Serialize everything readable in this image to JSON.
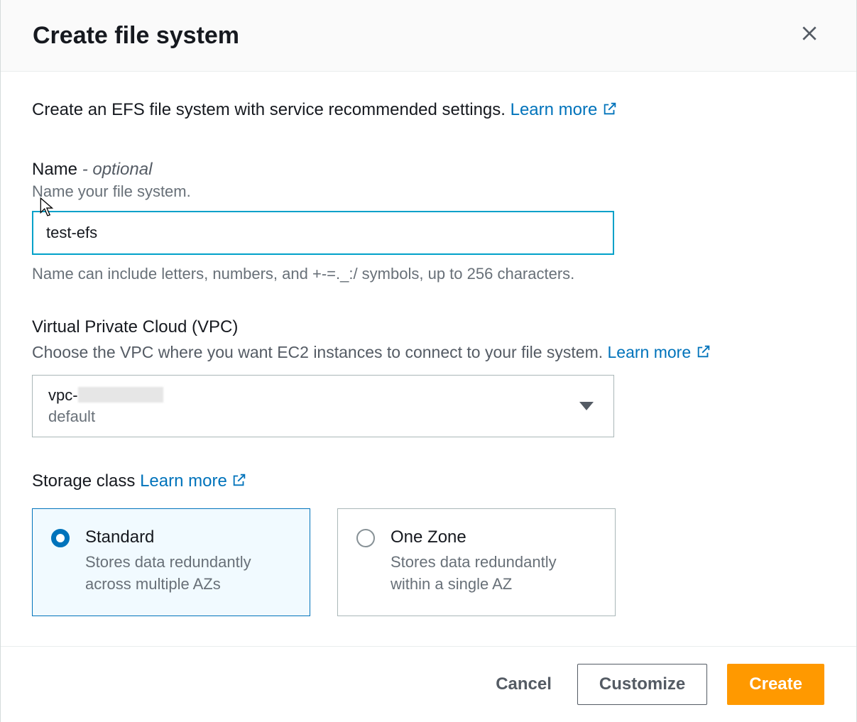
{
  "header": {
    "title": "Create file system"
  },
  "intro": {
    "text": "Create an EFS file system with service recommended settings. ",
    "learn_more": "Learn more"
  },
  "name_field": {
    "label": "Name",
    "optional_suffix": " - optional",
    "sublabel": "Name your file system.",
    "value": "test-efs",
    "constraint": "Name can include letters, numbers, and +-=._:/ symbols, up to 256 characters."
  },
  "vpc_field": {
    "label": "Virtual Private Cloud (VPC)",
    "sublabel_prefix": "Choose the VPC where you want EC2 instances to connect to your file system. ",
    "learn_more": "Learn more",
    "selected_line1_prefix": "vpc-",
    "selected_line2": "default"
  },
  "storage_field": {
    "label_prefix": "Storage class ",
    "learn_more": "Learn more",
    "options": [
      {
        "title": "Standard",
        "desc": "Stores data redundantly across multiple AZs",
        "selected": true
      },
      {
        "title": "One Zone",
        "desc": "Stores data redundantly within a single AZ",
        "selected": false
      }
    ]
  },
  "footer": {
    "cancel": "Cancel",
    "customize": "Customize",
    "create": "Create"
  }
}
